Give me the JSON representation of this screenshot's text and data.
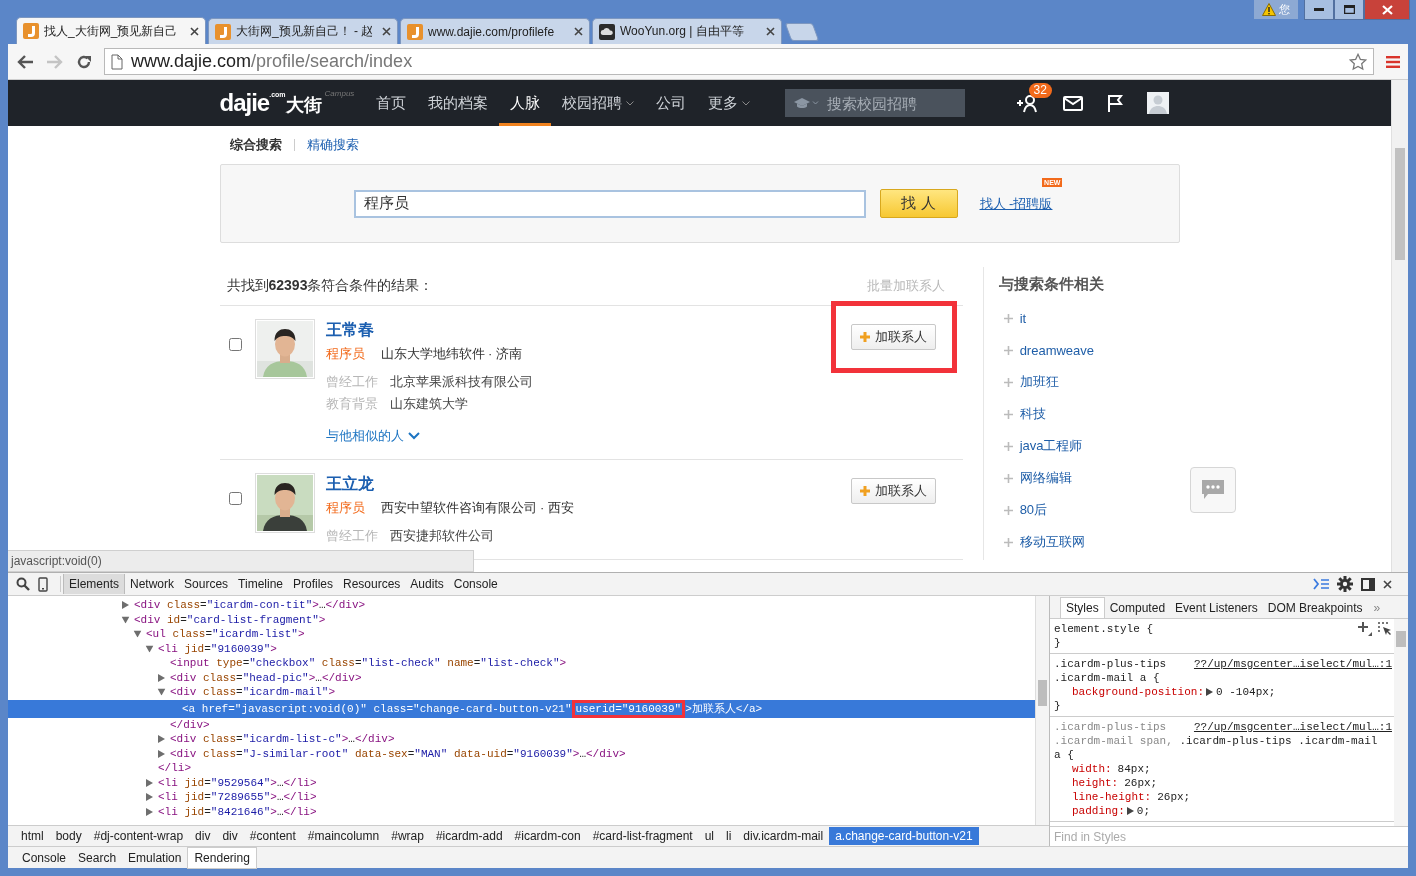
{
  "window": {
    "notice": "您"
  },
  "tabs": [
    {
      "title": "找人_大街网_预见新自己",
      "kind": "dajie",
      "selected": true
    },
    {
      "title": "大街网_预见新自己！ - 赵",
      "kind": "dajie",
      "selected": false
    },
    {
      "title": "www.dajie.com/profilefe",
      "kind": "dajie",
      "selected": false
    },
    {
      "title": "WooYun.org | 自由平等",
      "kind": "wooyun",
      "selected": false
    }
  ],
  "address": {
    "host": "www.dajie.com",
    "path": "/profile/search/index"
  },
  "site_nav": {
    "logo": {
      "name": "dajie",
      "cn": "大街",
      "tag": ".com",
      "sub": "Campus"
    },
    "items": [
      {
        "label": "首页",
        "selected": false,
        "menu": false
      },
      {
        "label": "我的档案",
        "selected": false,
        "menu": false
      },
      {
        "label": "人脉",
        "selected": true,
        "menu": false
      },
      {
        "label": "校园招聘",
        "selected": false,
        "menu": true
      },
      {
        "label": "公司",
        "selected": false,
        "menu": false
      },
      {
        "label": "更多",
        "selected": false,
        "menu": true
      }
    ],
    "search": {
      "placeholder": "搜索校园招聘"
    },
    "notifications": "32"
  },
  "search_tabs": [
    {
      "label": "综合搜索",
      "selected": true
    },
    {
      "label": "精确搜索",
      "selected": false
    }
  ],
  "search": {
    "value": "程序员",
    "button": "找 人",
    "alt_link": "找人 -招聘版",
    "alt_badge": "NEW"
  },
  "results": {
    "summary": "共找到**62393**条符合条件的结果：",
    "batch_action": "批量加联系人",
    "items": [
      {
        "name": "王常春",
        "title": "程序员",
        "location": "山东大学地纬软件 · 济南",
        "details": [
          {
            "label": "曾经工作",
            "value": "北京苹果派科技有限公司"
          },
          {
            "label": "教育背景",
            "value": "山东建筑大学"
          }
        ],
        "similar": "与他相似的人",
        "add_button": "加联系人",
        "checked": false,
        "highlighted": true
      },
      {
        "name": "王立龙",
        "title": "程序员",
        "location": "西安中望软件咨询有限公司 · 西安",
        "details": [
          {
            "label": "曾经工作",
            "value": "西安捷邦软件公司"
          }
        ],
        "add_button": "加联系人",
        "checked": false,
        "highlighted": false
      }
    ]
  },
  "related": {
    "title": "与搜索条件相关",
    "items": [
      "it",
      "dreamweave",
      "加班狂",
      "科技",
      "java工程师",
      "网络编辑",
      "80后",
      "移动互联网"
    ]
  },
  "status_link": "javascript:void(0)",
  "devtools": {
    "tabs": [
      {
        "label": "Elements",
        "selected": true
      },
      {
        "label": "Network",
        "selected": false
      },
      {
        "label": "Sources",
        "selected": false
      },
      {
        "label": "Timeline",
        "selected": false
      },
      {
        "label": "Profiles",
        "selected": false
      },
      {
        "label": "Resources",
        "selected": false
      },
      {
        "label": "Audits",
        "selected": false
      },
      {
        "label": "Console",
        "selected": false
      }
    ],
    "dom_tree": [
      {
        "markup": "<div class=\"icardm-con-tit\">…</div>",
        "expanded": false,
        "selected": false
      },
      {
        "markup": "<div id=\"card-list-fragment\">",
        "expanded": true,
        "selected": false,
        "children": [
          {
            "markup": "<ul class=\"icardm-list\">",
            "expanded": true,
            "selected": false,
            "children": [
              {
                "markup": "<li jid=\"9160039\">",
                "expanded": true,
                "selected": false,
                "close": "</li>",
                "children": [
                  {
                    "markup": "<input type=\"checkbox\" class=\"list-check\" name=\"list-check\">",
                    "selected": false
                  },
                  {
                    "markup": "<div class=\"head-pic\">…</div>",
                    "expanded": false,
                    "selected": false
                  },
                  {
                    "markup": "<div class=\"icardm-mail\">",
                    "expanded": true,
                    "selected": false,
                    "close": "</div>",
                    "children": [
                      {
                        "parts": [
                          {
                            "text": "<a href=\"javascript:void(0)\" class=\"change-card-button-v21\"",
                            "boxed": false
                          },
                          {
                            "text": " userid=\"9160039\"",
                            "boxed": true
                          },
                          {
                            "text": ">加联系人</a>",
                            "boxed": false
                          }
                        ],
                        "selected": true
                      }
                    ]
                  },
                  {
                    "markup": "<div class=\"icardm-list-c\">…</div>",
                    "expanded": false,
                    "selected": false
                  },
                  {
                    "markup": "<div class=\"J-similar-root\" data-sex=\"MAN\" data-uid=\"9160039\">…</div>",
                    "expanded": false,
                    "selected": false
                  }
                ]
              },
              {
                "markup": "<li jid=\"9529564\">…</li>",
                "expanded": false,
                "selected": false
              },
              {
                "markup": "<li jid=\"7289655\">…</li>",
                "expanded": false,
                "selected": false
              },
              {
                "markup": "<li jid=\"8421646\">…</li>",
                "expanded": false,
                "selected": false
              }
            ]
          }
        ]
      }
    ],
    "breadcrumbs": [
      {
        "label": "html",
        "selected": false
      },
      {
        "label": "body",
        "selected": false
      },
      {
        "label": "#dj-content-wrap",
        "selected": false
      },
      {
        "label": "div",
        "selected": false
      },
      {
        "label": "div",
        "selected": false
      },
      {
        "label": "#content",
        "selected": false
      },
      {
        "label": "#maincolumn",
        "selected": false
      },
      {
        "label": "#wrap",
        "selected": false
      },
      {
        "label": "#icardm-add",
        "selected": false
      },
      {
        "label": "#icardm-con",
        "selected": false
      },
      {
        "label": "#card-list-fragment",
        "selected": false
      },
      {
        "label": "ul",
        "selected": false
      },
      {
        "label": "li",
        "selected": false
      },
      {
        "label": "div.icardm-mail",
        "selected": false
      },
      {
        "label": "a.change-card-button-v21",
        "selected": true
      }
    ],
    "drawer_tabs": [
      {
        "label": "Console",
        "selected": false
      },
      {
        "label": "Search",
        "selected": false
      },
      {
        "label": "Emulation",
        "selected": false
      },
      {
        "label": "Rendering",
        "selected": true
      }
    ],
    "styles": {
      "tabs": [
        {
          "label": "Styles",
          "selected": true
        },
        {
          "label": "Computed",
          "selected": false
        },
        {
          "label": "Event Listeners",
          "selected": false
        },
        {
          "label": "DOM Breakpoints",
          "selected": false
        }
      ],
      "more": "»",
      "rules": [
        {
          "kind": "inline",
          "selector": [
            [
              {
                "text": "element.style {",
                "matched": true
              }
            ]
          ],
          "close": "}"
        },
        {
          "kind": "rule",
          "source": "??/up/msgcenter…iselect/mul…:1",
          "selector": [
            [
              {
                "text": ".icardm-plus-tips",
                "matched": true
              }
            ],
            [
              {
                "text": ".icardm-mail a {",
                "matched": true
              }
            ]
          ],
          "properties": [
            {
              "name": "background-position:",
              "value": "0 -104px;",
              "shorthand": true
            }
          ],
          "close": "}"
        },
        {
          "kind": "rule",
          "source": "??/up/msgcenter…iselect/mul…:1",
          "selector": [
            [
              {
                "text": ".icardm-plus-tips",
                "matched": false
              }
            ],
            [
              {
                "text": ".icardm-mail span,",
                "matched": false
              },
              {
                "text": " .icardm-plus-tips .icardm-mail",
                "matched": true
              }
            ],
            [
              {
                "text": "a {",
                "matched": true
              }
            ]
          ],
          "properties": [
            {
              "name": "width:",
              "value": "84px;",
              "shorthand": false
            },
            {
              "name": "height:",
              "value": "26px;",
              "shorthand": false
            },
            {
              "name": "line-height:",
              "value": "26px;",
              "shorthand": false
            },
            {
              "name": "padding:",
              "value": "0;",
              "shorthand": true
            }
          ]
        }
      ],
      "filter_placeholder": "Find in Styles"
    }
  }
}
